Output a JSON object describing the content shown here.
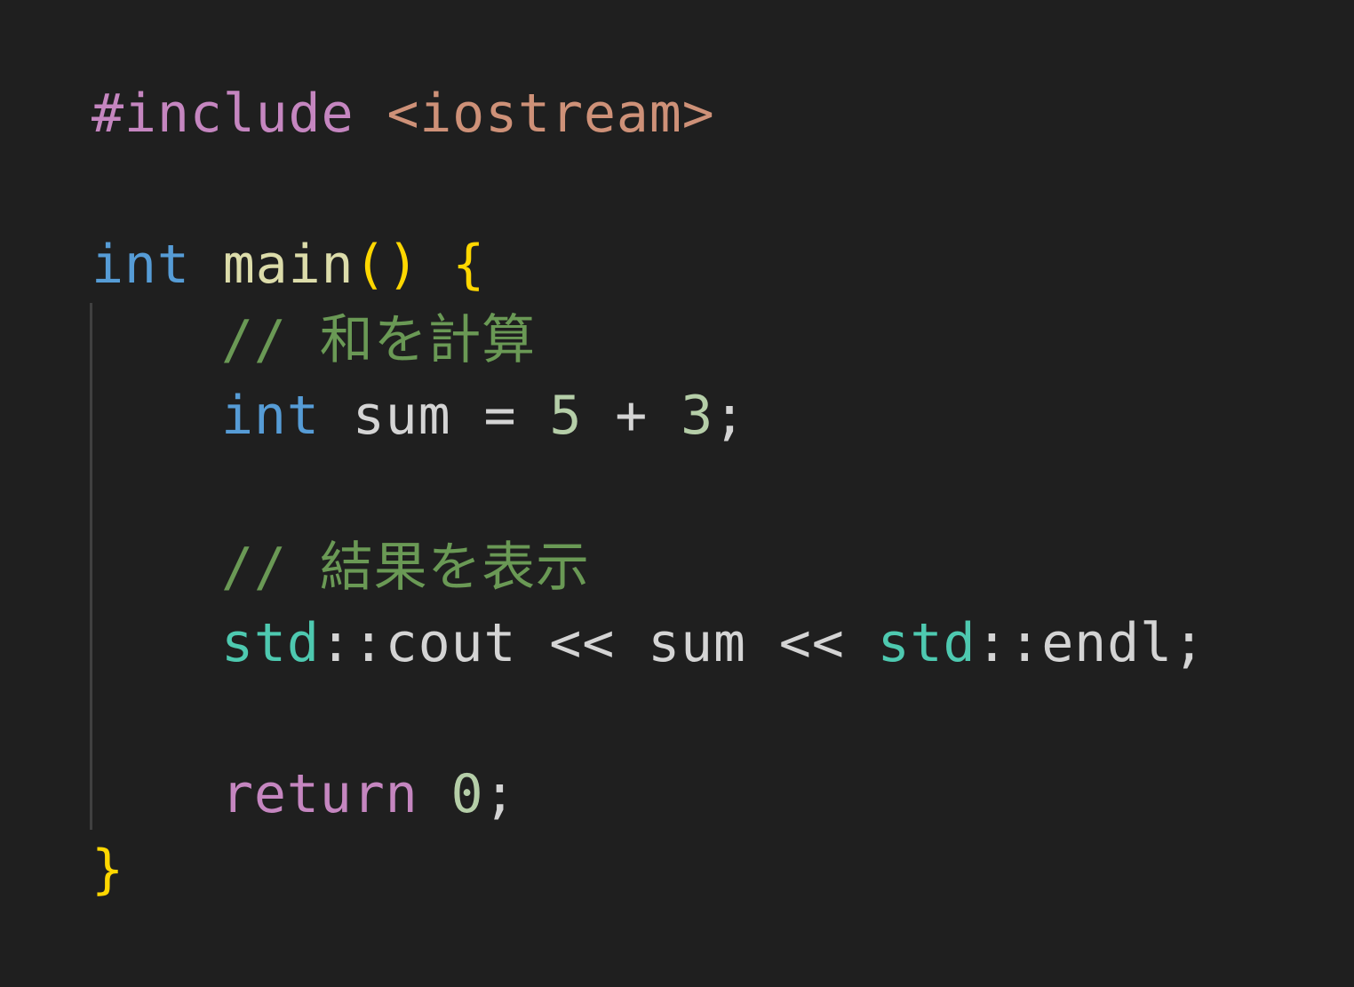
{
  "colors": {
    "background": "#1f1f1f",
    "preprocessor": "#c586c0",
    "include_path": "#ce9178",
    "keyword_type": "#569cd6",
    "function": "#dcdcaa",
    "bracket": "#ffd700",
    "comment": "#6a9955",
    "identifier": "#d4d4d4",
    "number": "#b5cea8",
    "namespace": "#4ec9b0",
    "control_keyword": "#c586c0",
    "indent_guide": "#404040"
  },
  "code": {
    "line1": {
      "directive": "#include",
      "path": "<iostream>"
    },
    "line3": {
      "type": "int",
      "func": "main",
      "parens": "()",
      "brace_open": "{"
    },
    "line4": {
      "comment": "// 和を計算"
    },
    "line5": {
      "type": "int",
      "ident": "sum",
      "op_assign": "=",
      "num_a": "5",
      "op_plus": "+",
      "num_b": "3",
      "semi": ";"
    },
    "line7": {
      "comment": "// 結果を表示"
    },
    "line8": {
      "ns1": "std",
      "sep1": "::",
      "ident1": "cout",
      "op1": "<<",
      "ident2": "sum",
      "op2": "<<",
      "ns2": "std",
      "sep2": "::",
      "ident3": "endl",
      "semi": ";"
    },
    "line10": {
      "keyword": "return",
      "num": "0",
      "semi": ";"
    },
    "line11": {
      "brace_close": "}"
    }
  }
}
